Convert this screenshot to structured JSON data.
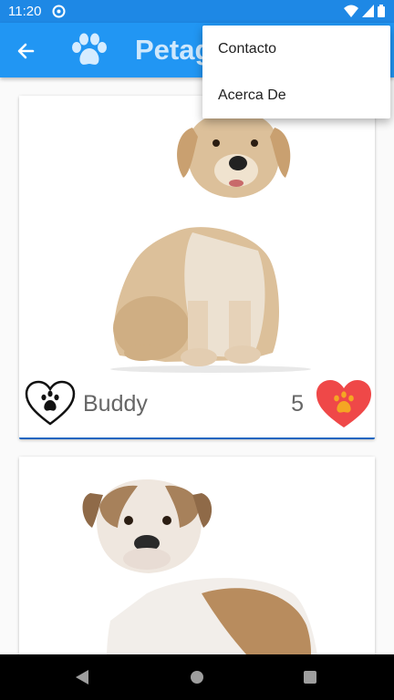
{
  "status_bar": {
    "time": "11:20"
  },
  "app_bar": {
    "title": "Petagram",
    "icons": {
      "back": "arrow-back-icon",
      "logo": "paw-print-icon"
    }
  },
  "menu": {
    "items": [
      {
        "label": "Contacto"
      },
      {
        "label": "Acerca De"
      }
    ]
  },
  "pets": [
    {
      "name": "Buddy",
      "rating": "5",
      "photo": "golden-retriever-puppy"
    },
    {
      "name": "",
      "rating": "",
      "photo": "english-bulldog-puppy"
    }
  ],
  "colors": {
    "status_bar": "#1e88e5",
    "app_bar": "#2196f3",
    "rating_heart": "#ef4848",
    "rating_paw": "#f5a623",
    "nav_bar": "#000000"
  }
}
